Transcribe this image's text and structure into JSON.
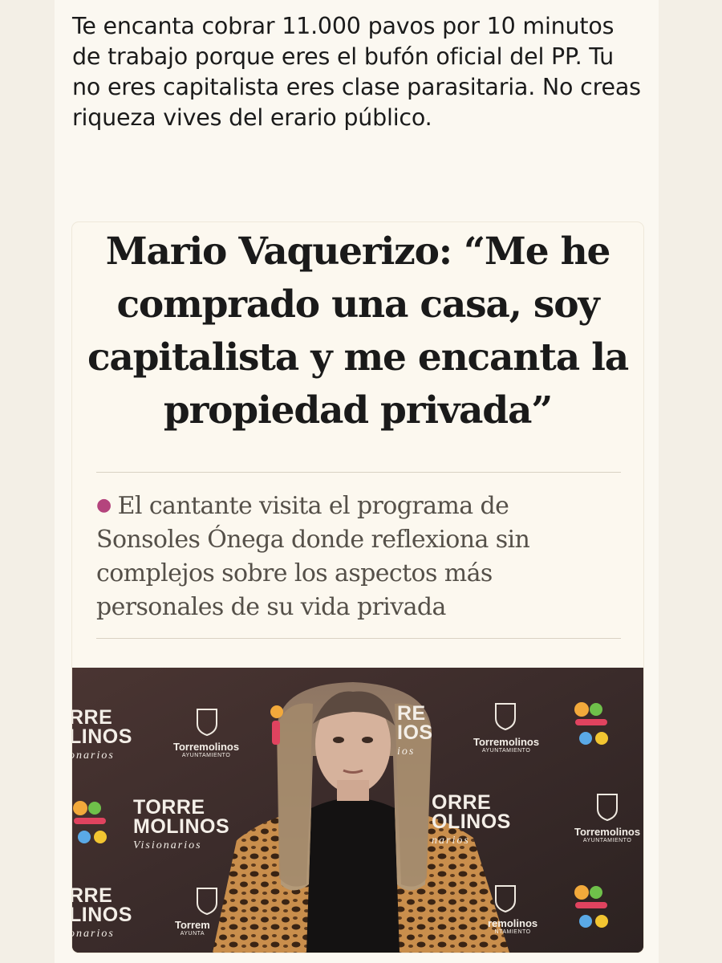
{
  "post": {
    "text": "Te encanta cobrar 11.000 pavos por 10 minutos de trabajo porque eres el bufón oficial del PP. Tu no eres capitalista eres clase parasitaria. No creas riqueza vives del erario público."
  },
  "article": {
    "headline": "Mario Vaquerizo: “Me he comprado una casa, soy capitalista y me encanta la propiedad privada”",
    "subheadline": "El cantante visita el programa de Sonsoles Ónega donde reflexiona sin complejos sobre los aspectos más personales de su vida privada",
    "bullet_color": "#b4447d"
  },
  "photo": {
    "description_icon": "person-photo",
    "backdrop": {
      "brand_line1": "TORRE",
      "brand_line2": "MOLINOS",
      "brand_sub": "Visionarios",
      "town_name": "Torremolinos",
      "town_sub": "AYUNTAMIENTO",
      "partial_brand1": "RRE",
      "partial_brand2": "LINOS",
      "partial_sub": "onarios",
      "partial_center1": "RE",
      "partial_center2": "IOS",
      "partial_center_sub": "ios",
      "right_brand1": "ORRE",
      "right_brand2": "OLINOS",
      "right_sub": "narios",
      "partial_town": "remolinos",
      "partial_town_sub": "NTAMIENTO",
      "partial_town_left": "Torrem",
      "partial_town_left_sub": "AYUNTA",
      "right_town": "Torremolinos",
      "right_town_sub": "AYUNTAMIENTO"
    }
  }
}
